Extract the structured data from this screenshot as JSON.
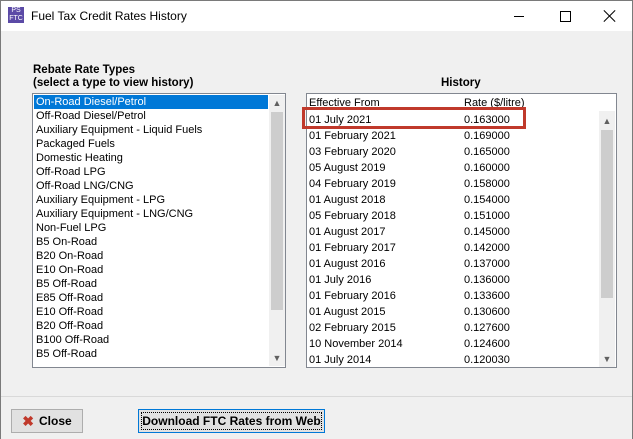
{
  "window": {
    "title": "Fuel Tax Credit Rates History",
    "icon_text_top": "PS",
    "icon_text_bottom": "FTC"
  },
  "rebate": {
    "heading_line1": "Rebate Rate Types",
    "heading_line2": "(select a type to view history)",
    "items": [
      "On-Road Diesel/Petrol",
      "Off-Road Diesel/Petrol",
      "Auxiliary Equipment - Liquid Fuels",
      "Packaged Fuels",
      "Domestic Heating",
      "Off-Road LPG",
      "Off-Road LNG/CNG",
      "Auxiliary Equipment - LPG",
      "Auxiliary Equipment - LNG/CNG",
      "Non-Fuel LPG",
      "B5 On-Road",
      "B20 On-Road",
      "E10 On-Road",
      "B5 Off-Road",
      "E85 Off-Road",
      "E10 Off-Road",
      "B20 Off-Road",
      "B100 Off-Road",
      "B5 Off-Road"
    ],
    "selected_index": 0
  },
  "history": {
    "heading": "History",
    "col_date": "Effective From",
    "col_rate": "Rate ($/litre)",
    "rows": [
      {
        "date": "01 July 2021",
        "rate": "0.163000"
      },
      {
        "date": "01 February 2021",
        "rate": "0.169000"
      },
      {
        "date": "03 February 2020",
        "rate": "0.165000"
      },
      {
        "date": "05 August 2019",
        "rate": "0.160000"
      },
      {
        "date": "04 February 2019",
        "rate": "0.158000"
      },
      {
        "date": "01 August 2018",
        "rate": "0.154000"
      },
      {
        "date": "05 February 2018",
        "rate": "0.151000"
      },
      {
        "date": "01 August 2017",
        "rate": "0.145000"
      },
      {
        "date": "01 February 2017",
        "rate": "0.142000"
      },
      {
        "date": "01 August 2016",
        "rate": "0.137000"
      },
      {
        "date": "01 July 2016",
        "rate": "0.136000"
      },
      {
        "date": "01 February 2016",
        "rate": "0.133600"
      },
      {
        "date": "01 August 2015",
        "rate": "0.130600"
      },
      {
        "date": "02 February 2015",
        "rate": "0.127600"
      },
      {
        "date": "10 November 2014",
        "rate": "0.124600"
      },
      {
        "date": "01 July 2014",
        "rate": "0.120030"
      }
    ],
    "highlight_color": "#c0392b"
  },
  "buttons": {
    "close_label": "Close",
    "download_label": "Download FTC Rates from Web"
  },
  "colors": {
    "selection": "#0078d7",
    "close_icon": "#c0392b"
  }
}
